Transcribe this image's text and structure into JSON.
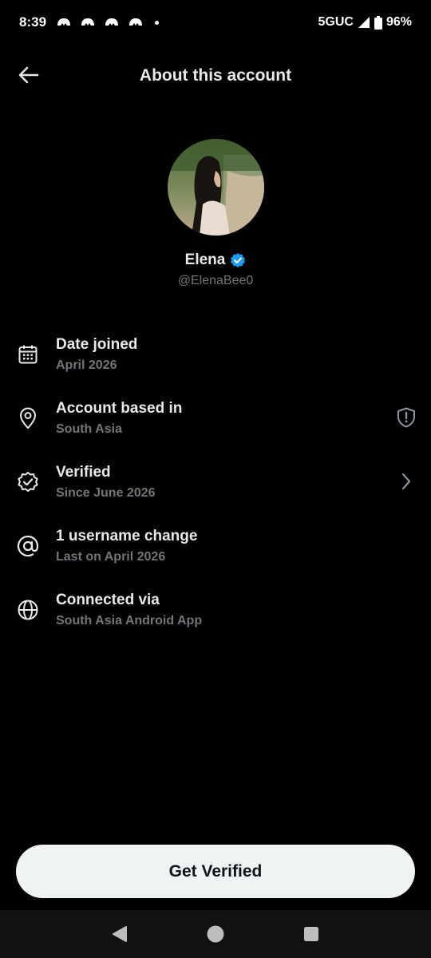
{
  "status_bar": {
    "time": "8:39",
    "network": "5GUC",
    "battery": "96%"
  },
  "app_bar": {
    "title": "About this account"
  },
  "profile": {
    "name": "Elena",
    "handle": "@ElenaBee0",
    "verified_color": "#1d9bf0"
  },
  "info": [
    {
      "icon": "calendar-icon",
      "title": "Date joined",
      "subtitle": "April 2026"
    },
    {
      "icon": "location-pin-icon",
      "title": "Account based in",
      "subtitle": "South Asia",
      "trailing": "shield-alert-icon"
    },
    {
      "icon": "verified-badge-icon",
      "title": "Verified",
      "subtitle": "Since June 2026",
      "trailing": "chevron-right-icon"
    },
    {
      "icon": "at-sign-icon",
      "title": "1 username change",
      "subtitle": "Last on April 2026"
    },
    {
      "icon": "globe-icon",
      "title": "Connected via",
      "subtitle": "South Asia Android App"
    }
  ],
  "cta": {
    "label": "Get Verified"
  },
  "colors": {
    "background": "#000000",
    "primary_text": "#e7e9ea",
    "secondary_text": "#71767b",
    "button_bg": "#eff3f4"
  }
}
